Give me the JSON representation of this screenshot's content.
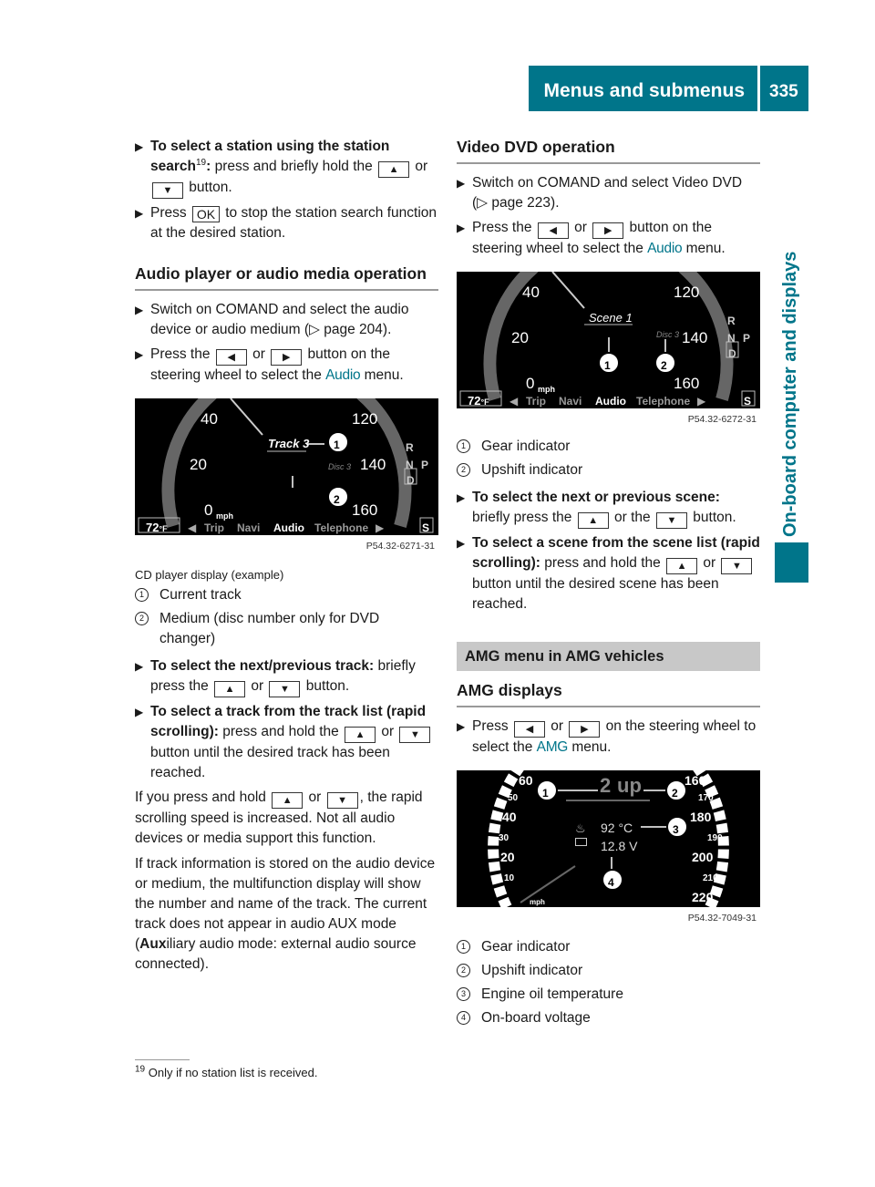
{
  "header": {
    "title": "Menus and submenus",
    "page_number": "335"
  },
  "side_tab": {
    "label": "On-board computer and displays",
    "color": "#00758a"
  },
  "left": {
    "step1": {
      "bold": "To select a station using the station search",
      "sup": "19",
      "colon": ":",
      "text_a": " press and briefly hold the ",
      "key_up": "▲",
      "or": " or ",
      "key_down": "▼",
      "text_b": " button."
    },
    "step2": {
      "text_a": "Press ",
      "key_ok": "OK",
      "text_b": " to stop the station search function at the desired station."
    },
    "section_title": "Audio player or audio media operation",
    "step3": {
      "text": "Switch on COMAND and select the audio device or audio medium (▷ page 204)."
    },
    "step4": {
      "text_a": "Press the ",
      "key_left": "◀",
      "or": " or ",
      "key_right": "▶",
      "text_b": " button on the steering wheel to select the ",
      "menu": "Audio",
      "text_c": " menu."
    },
    "figure": {
      "speeds_left": [
        "40",
        "20",
        "0"
      ],
      "unit": "mph",
      "speeds_right": [
        "120",
        "140",
        "160"
      ],
      "track": "Track 3",
      "disc": "Disc 3",
      "temp": "72",
      "temp_unit": "°F",
      "menu": [
        "Trip",
        "Navi",
        "Audio",
        "Telephone"
      ],
      "active_menu": "Audio",
      "gears": [
        "R",
        "N",
        "D"
      ],
      "park": "P",
      "s_badge": "S",
      "callouts": [
        "1",
        "2"
      ],
      "id": "P54.32-6271-31"
    },
    "caption": "CD player display (example)",
    "legend": [
      {
        "num": "1",
        "text": "Current track"
      },
      {
        "num": "2",
        "text": "Medium (disc number only for DVD changer)"
      }
    ],
    "step5": {
      "bold": "To select the next/previous track:",
      "text_a": " briefly press the ",
      "key_up": "▲",
      "or": " or ",
      "key_down": "▼",
      "text_b": " button."
    },
    "step6": {
      "bold": "To select a track from the track list (rapid scrolling):",
      "text_a": " press and hold the ",
      "key_up": "▲",
      "or": " or ",
      "key_down": "▼",
      "text_b": " button until the desired track has been reached."
    },
    "para1": {
      "text_a": "If you press and hold ",
      "key_up": "▲",
      "or": " or ",
      "key_down": "▼",
      "text_b": ", the rapid scrolling speed is increased. Not all audio devices or media support this function."
    },
    "para2": {
      "text_a": "If track information is stored on the audio device or medium, the multifunction display will show the number and name of the track. The current track does not appear in audio AUX mode (",
      "bold_aux": "Aux",
      "text_b": "iliary audio mode: external audio source connected)."
    }
  },
  "right": {
    "section_title": "Video DVD operation",
    "step1": {
      "text": "Switch on COMAND and select Video DVD (▷ page 223)."
    },
    "step2": {
      "text_a": "Press the ",
      "key_left": "◀",
      "or": " or ",
      "key_right": "▶",
      "text_b": " button on the steering wheel to select the ",
      "menu": "Audio",
      "text_c": " menu."
    },
    "figure": {
      "scene": "Scene 1",
      "disc": "Disc 3",
      "temp": "72",
      "temp_unit": "°F",
      "speeds_left": [
        "40",
        "20",
        "0"
      ],
      "unit": "mph",
      "speeds_right": [
        "120",
        "140",
        "160"
      ],
      "menu": [
        "Trip",
        "Navi",
        "Audio",
        "Telephone"
      ],
      "active_menu": "Audio",
      "gears": [
        "R",
        "N",
        "D"
      ],
      "park": "P",
      "s_badge": "S",
      "callouts": [
        "1",
        "2"
      ],
      "id": "P54.32-6272-31"
    },
    "legend": [
      {
        "num": "1",
        "text": "Gear indicator"
      },
      {
        "num": "2",
        "text": "Upshift indicator"
      },
      {
        "num": "3",
        "text": "Engine oil temperature"
      },
      {
        "num": "4",
        "text": "On-board voltage"
      }
    ],
    "step3": {
      "bold": "To select the next or previous scene:",
      "text_a": " briefly press the ",
      "key_up": "▲",
      "or": " or the ",
      "key_down": "▼",
      "text_b": " button."
    },
    "step4": {
      "bold": "To select a scene from the scene list (rapid scrolling):",
      "text_a": " press and hold the ",
      "key_up": "▲",
      "or": " or ",
      "key_down": "▼",
      "text_b": " button until the desired scene has been reached."
    },
    "amg_heading": "AMG menu in AMG vehicles",
    "amg_subheading": "AMG displays",
    "step5": {
      "text_a": "Press ",
      "key_left": "◀",
      "or": " or ",
      "key_right": "▶",
      "text_b": " on the steering wheel to select the ",
      "menu": "AMG",
      "text_c": " menu."
    },
    "amg_figure": {
      "speeds_left": [
        "60",
        "50",
        "40",
        "30",
        "20",
        "10"
      ],
      "unit": "mph",
      "speeds_right": [
        "160",
        "170",
        "180",
        "190",
        "200",
        "210",
        "220"
      ],
      "gear": "2",
      "upshift": "up",
      "oil_temp": "92 °C",
      "voltage": "12.8 V",
      "callouts": [
        "1",
        "2",
        "3",
        "4"
      ],
      "id": "P54.32-7049-31"
    }
  },
  "footnote": {
    "num": "19",
    "text": " Only if no station list is received."
  }
}
